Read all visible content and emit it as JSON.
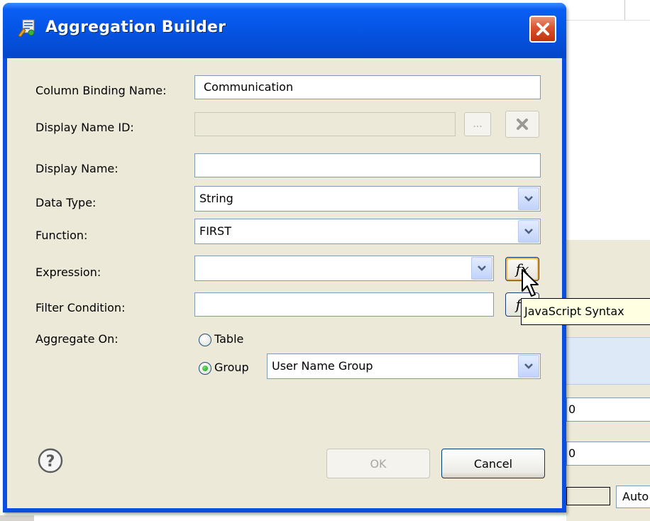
{
  "background": {
    "field1_text": "0",
    "field2_text": "0",
    "auto_text": "Auto"
  },
  "dialog": {
    "title": "Aggregation Builder",
    "labels": {
      "column_binding_name": "Column Binding Name:",
      "display_name_id": "Display Name ID:",
      "display_name": "Display Name:",
      "data_type": "Data Type:",
      "function": "Function:",
      "expression": "Expression:",
      "filter_condition": "Filter Condition:",
      "aggregate_on": "Aggregate On:"
    },
    "values": {
      "column_binding_name": "Communication",
      "display_name_id": "",
      "display_name": "",
      "data_type": "String",
      "function": "FIRST",
      "expression": "",
      "filter_condition": "",
      "group_selection": "User Name Group"
    },
    "ellipsis_label": "...",
    "fx_label": "fx",
    "radio": {
      "table_label": "Table",
      "group_label": "Group",
      "selected": "Group"
    },
    "buttons": {
      "ok": "OK",
      "cancel": "Cancel"
    },
    "tooltip": "JavaScript Syntax"
  },
  "colors": {
    "titlebar": "#0554e4",
    "dialog_body": "#ece9d8",
    "close_button": "#d9532f",
    "tooltip_bg": "#ffffe1"
  }
}
